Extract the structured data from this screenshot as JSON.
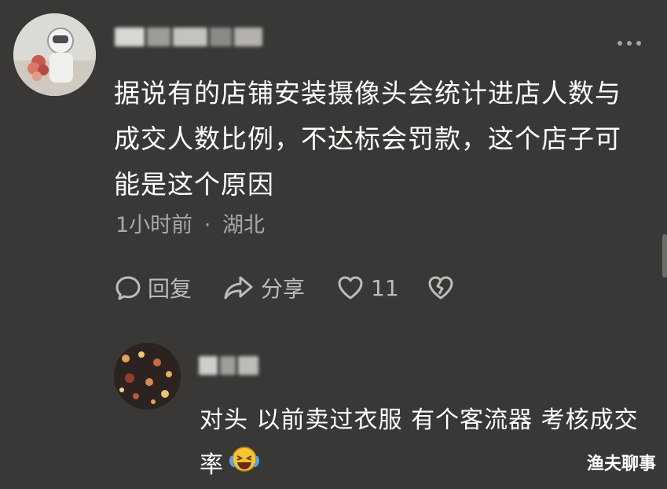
{
  "colors": {
    "background": "#393836",
    "text": "#ffffff",
    "secondary": "#a9a8a4",
    "icon": "#bdbcb8"
  },
  "comment": {
    "text": "据说有的店铺安装摄像头会统计进店人数与成交人数比例，不达标会罚款，这个店子可能是这个原因",
    "time": "1小时前",
    "separator": "·",
    "location": "湖北",
    "actions": {
      "reply_label": "回复",
      "share_label": "分享",
      "like_count": "11"
    }
  },
  "reply": {
    "text": "对头  以前卖过衣服  有个客流器  考核成交率",
    "emoji": "laughing-crying-emoji"
  },
  "watermark": "渔夫聊事",
  "icons": [
    "more-icon",
    "comment-icon",
    "share-arrow-icon",
    "heart-icon",
    "broken-heart-icon"
  ]
}
